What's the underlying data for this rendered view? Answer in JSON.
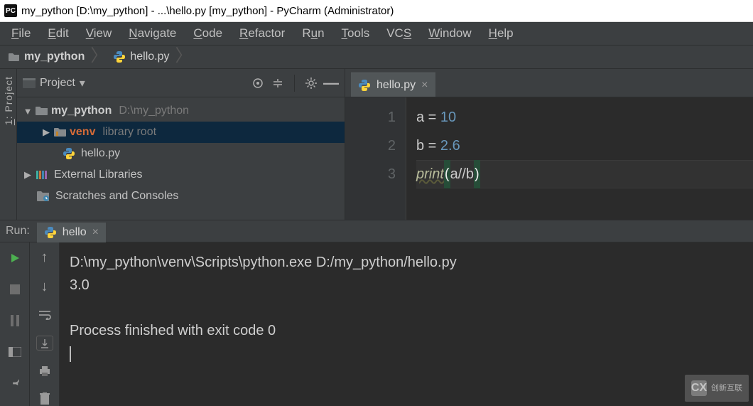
{
  "window": {
    "title": "my_python [D:\\my_python] - ...\\hello.py [my_python] - PyCharm (Administrator)",
    "logo_text": "PC"
  },
  "menu": {
    "file": "File",
    "edit": "Edit",
    "view": "View",
    "navigate": "Navigate",
    "code": "Code",
    "refactor": "Refactor",
    "run": "Run",
    "tools": "Tools",
    "vcs": "VCS",
    "window": "Window",
    "help": "Help"
  },
  "breadcrumb": {
    "root": "my_python",
    "file": "hello.py"
  },
  "sidebar_tab": {
    "label": "1: Project"
  },
  "project_panel": {
    "title": "Project",
    "tree": {
      "root_name": "my_python",
      "root_path": "D:\\my_python",
      "venv_name": "venv",
      "venv_hint": "library root",
      "file1": "hello.py",
      "ext_lib": "External Libraries",
      "scratches": "Scratches and Consoles"
    }
  },
  "editor": {
    "tab_name": "hello.py",
    "lines": {
      "l1_num": "1",
      "l2_num": "2",
      "l3_num": "3",
      "l1_a": "a",
      "l1_eq": " = ",
      "l1_v": "10",
      "l2_a": "b",
      "l2_eq": " = ",
      "l2_v": "2.6",
      "l3_fn": "print",
      "l3_po": "(",
      "l3_a1": "a",
      "l3_op": "//",
      "l3_a2": "b",
      "l3_pc": ")"
    }
  },
  "run": {
    "label": "Run:",
    "tab": "hello",
    "console": {
      "cmd": "D:\\my_python\\venv\\Scripts\\python.exe D:/my_python/hello.py",
      "out1": "3.0",
      "blank": "",
      "exit": "Process finished with exit code 0"
    }
  },
  "watermark": {
    "logo": "CX",
    "text": "创新互联"
  }
}
